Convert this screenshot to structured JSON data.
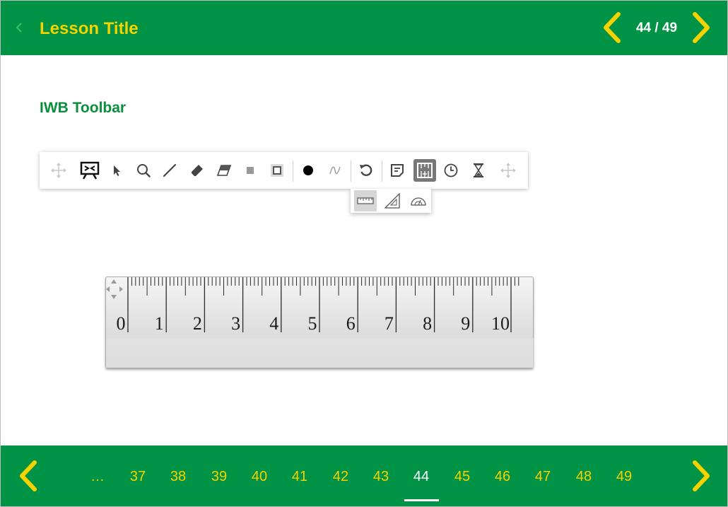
{
  "colors": {
    "brand_green": "#009245",
    "accent_yellow": "#f5d200",
    "section_green": "#0a8f3c",
    "text_white": "#ffffff"
  },
  "header": {
    "title": "Lesson Title",
    "page_counter": "44 / 49",
    "back_icon": "chevron-left-icon",
    "prev_icon": "chevron-left-icon",
    "next_icon": "chevron-right-icon"
  },
  "section": {
    "title": "IWB Toolbar"
  },
  "toolbar": {
    "tools": [
      "move-handle-icon",
      "presentation-board-icon",
      "pointer-icon",
      "magnifier-icon",
      "line-icon",
      "marker-icon",
      "eraser-icon",
      "small-square-icon",
      "frame-square-icon",
      "color-dot-icon",
      "freehand-curve-icon",
      "undo-icon",
      "sticky-note-icon",
      "measure-tools-icon",
      "clock-icon",
      "hourglass-icon",
      "move-handle-icon"
    ],
    "active_tool": "measure-tools-icon",
    "measure_submenu": [
      "ruler-icon",
      "set-square-icon",
      "protractor-icon"
    ],
    "active_subtool": "ruler-icon"
  },
  "ruler": {
    "numbers": [
      "0",
      "1",
      "2",
      "3",
      "4",
      "5",
      "6",
      "7",
      "8",
      "9",
      "10"
    ]
  },
  "footer": {
    "ellipsis": "…",
    "pages": [
      "37",
      "38",
      "39",
      "40",
      "41",
      "42",
      "43",
      "44",
      "45",
      "46",
      "47",
      "48",
      "49"
    ],
    "current_page": "44",
    "prev_icon": "chevron-left-icon",
    "next_icon": "chevron-right-icon"
  }
}
